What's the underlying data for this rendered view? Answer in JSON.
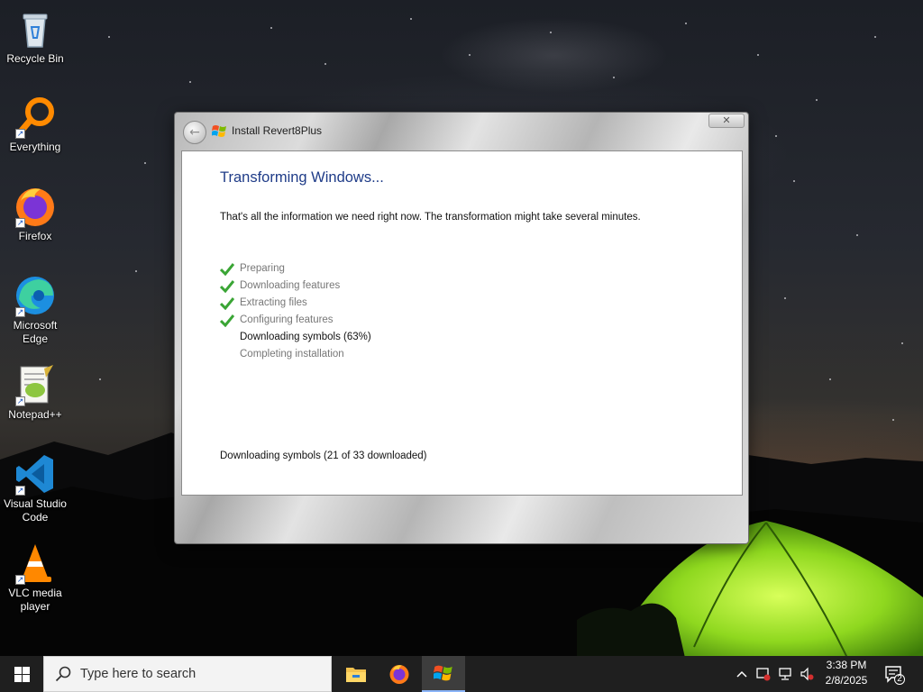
{
  "desktop": {
    "icons": [
      {
        "label": "Recycle Bin",
        "icon": "recycle-bin-icon"
      },
      {
        "label": "Everything",
        "icon": "everything-search-icon"
      },
      {
        "label": "Firefox",
        "icon": "firefox-icon"
      },
      {
        "label": "Microsoft Edge",
        "icon": "edge-icon"
      },
      {
        "label": "Notepad++",
        "icon": "notepad-plus-plus-icon"
      },
      {
        "label": "Visual Studio Code",
        "icon": "vscode-icon"
      },
      {
        "label": "VLC media player",
        "icon": "vlc-icon"
      }
    ]
  },
  "installer": {
    "title": "Install Revert8Plus",
    "heading": "Transforming Windows...",
    "info": "That's all the information we need right now. The transformation might take several minutes.",
    "steps": [
      {
        "label": "Preparing",
        "state": "done"
      },
      {
        "label": "Downloading features",
        "state": "done"
      },
      {
        "label": "Extracting files",
        "state": "done"
      },
      {
        "label": "Configuring features",
        "state": "done"
      },
      {
        "label": "Downloading symbols (63%)",
        "state": "current"
      },
      {
        "label": "Completing installation",
        "state": "pending"
      }
    ],
    "status": "Downloading symbols (21 of 33 downloaded)",
    "close_label": "✕"
  },
  "taskbar": {
    "search_placeholder": "Type here to search",
    "apps": [
      "file-explorer-icon",
      "firefox-icon",
      "installer-icon"
    ],
    "clock_time": "3:38 PM",
    "clock_date": "2/8/2025",
    "notification_count": "2"
  },
  "colors": {
    "heading": "#1f3c88",
    "check": "#3aa535",
    "taskbar": "#1f1f1f"
  }
}
